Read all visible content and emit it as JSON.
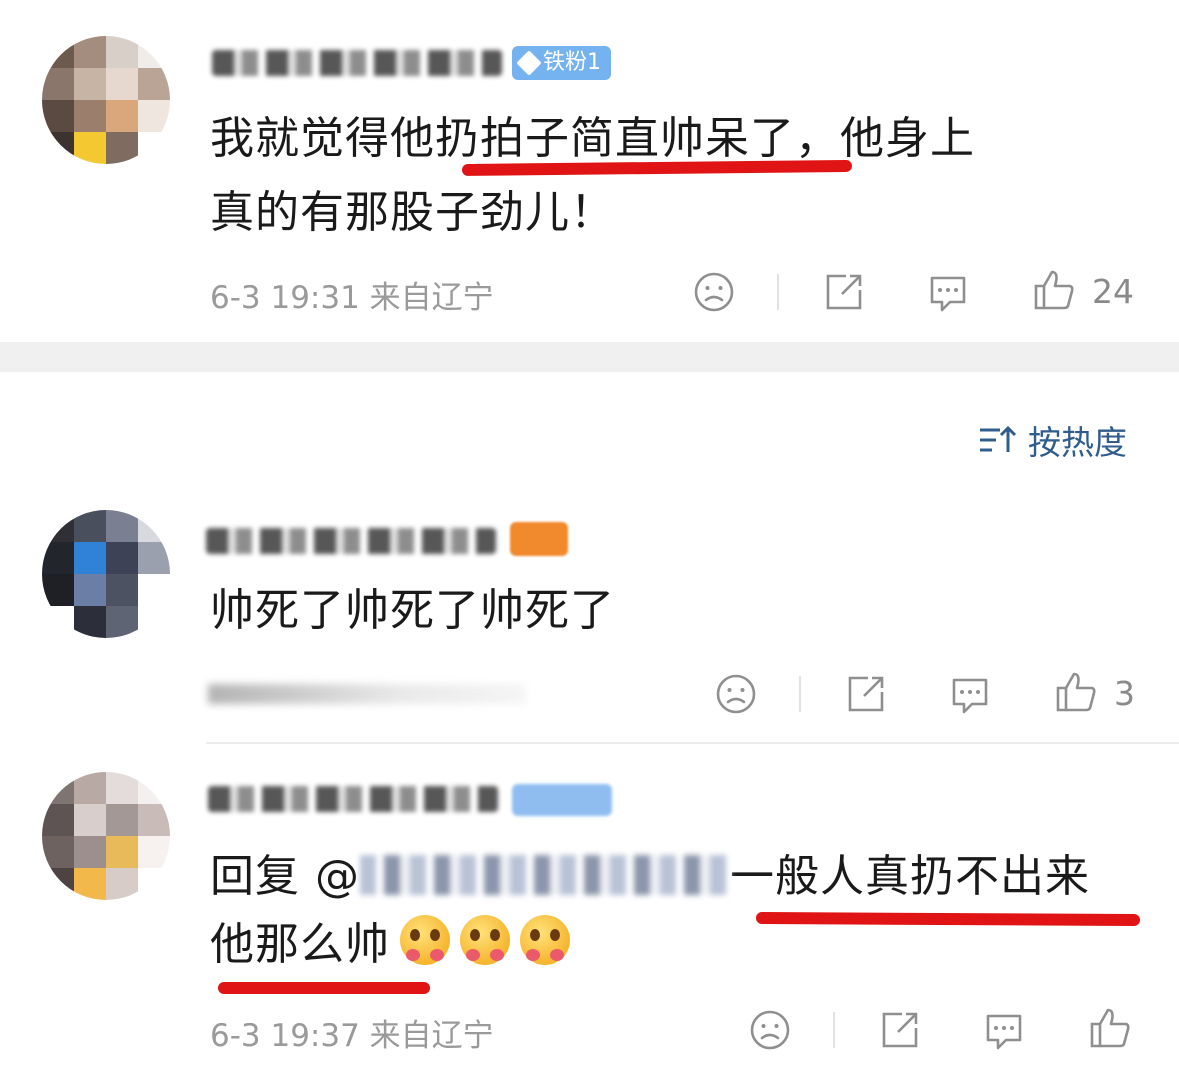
{
  "comment1": {
    "badge_label": "铁粉1",
    "text_line1": "我就觉得他扔拍子简直帅呆了，他身上",
    "text_line2": "真的有那股子劲儿！",
    "meta": "6-3 19:31 来自辽宁",
    "like_count": "24"
  },
  "sort": {
    "label": "按热度"
  },
  "comment2": {
    "text": "帅死了帅死了帅死了",
    "like_count": "3"
  },
  "comment3": {
    "reply_prefix": "回复 @",
    "text_line1_tail": "一般人真扔不出来",
    "text_line2": "他那么帅",
    "meta": "6-3 19:37 来自辽宁"
  },
  "icons": {
    "dislike": "sad-face-icon",
    "share": "share-icon",
    "comment": "comment-bubble-icon",
    "like": "thumbs-up-icon",
    "sort": "sort-icon",
    "badge": "diamond-icon"
  },
  "colors": {
    "accent_blue": "#74b2f0",
    "badge_orange": "#f08a2c",
    "highlight_red": "#e01414",
    "meta_gray": "#9a9a9a",
    "section_gray": "#f0f0f0"
  }
}
